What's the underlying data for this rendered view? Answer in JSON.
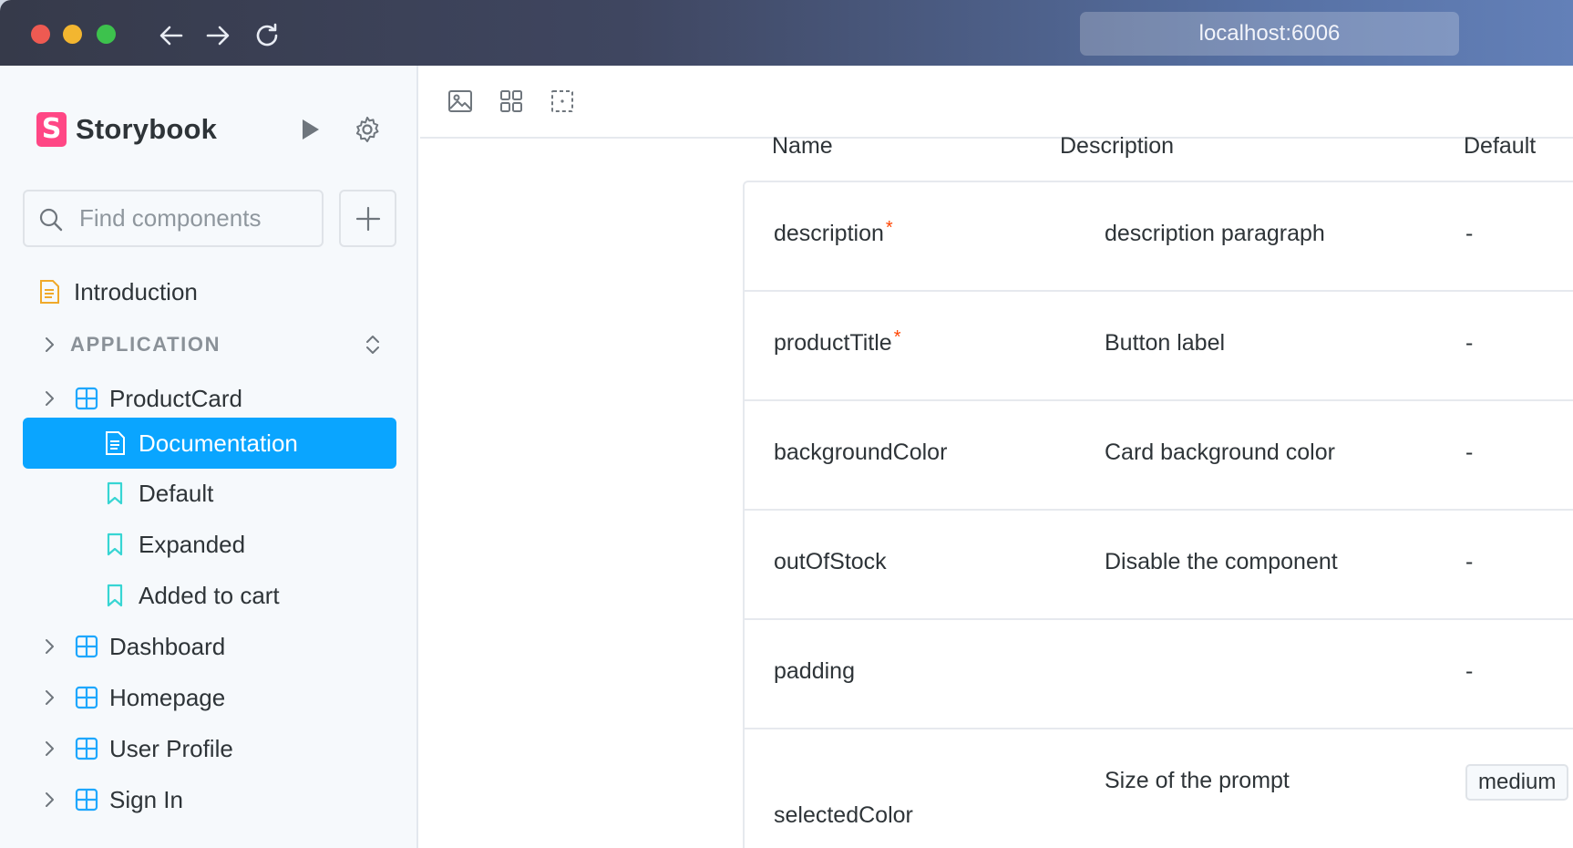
{
  "browser": {
    "url": "localhost:6006"
  },
  "sidebar": {
    "brand": "Storybook",
    "search_placeholder": "Find components",
    "intro": "Introduction",
    "section": "APPLICATION",
    "items": [
      {
        "label": "ProductCard"
      },
      {
        "label": "Documentation"
      },
      {
        "label": "Default"
      },
      {
        "label": "Expanded"
      },
      {
        "label": "Added to cart"
      },
      {
        "label": "Dashboard"
      },
      {
        "label": "Homepage"
      },
      {
        "label": "User Profile"
      },
      {
        "label": "Sign In"
      }
    ]
  },
  "table": {
    "headers": {
      "name": "Name",
      "description": "Description",
      "default": "Default"
    },
    "required_mark": "*",
    "rows": [
      {
        "name": "description",
        "description": "description paragraph",
        "default": "-"
      },
      {
        "name": "productTitle",
        "description": "Button label",
        "default": "-"
      },
      {
        "name": "backgroundColor",
        "description": "Card background color",
        "default": "-"
      },
      {
        "name": "outOfStock",
        "description": "Disable the component",
        "default": "-"
      },
      {
        "name": "padding",
        "description": "",
        "default": "-"
      },
      {
        "name": "selectedColor",
        "description": "Size of the prompt",
        "default": "medium"
      }
    ]
  },
  "colors": {
    "accent": "#0aa5ff",
    "brand": "#ff4785",
    "required": "#ff4400"
  }
}
